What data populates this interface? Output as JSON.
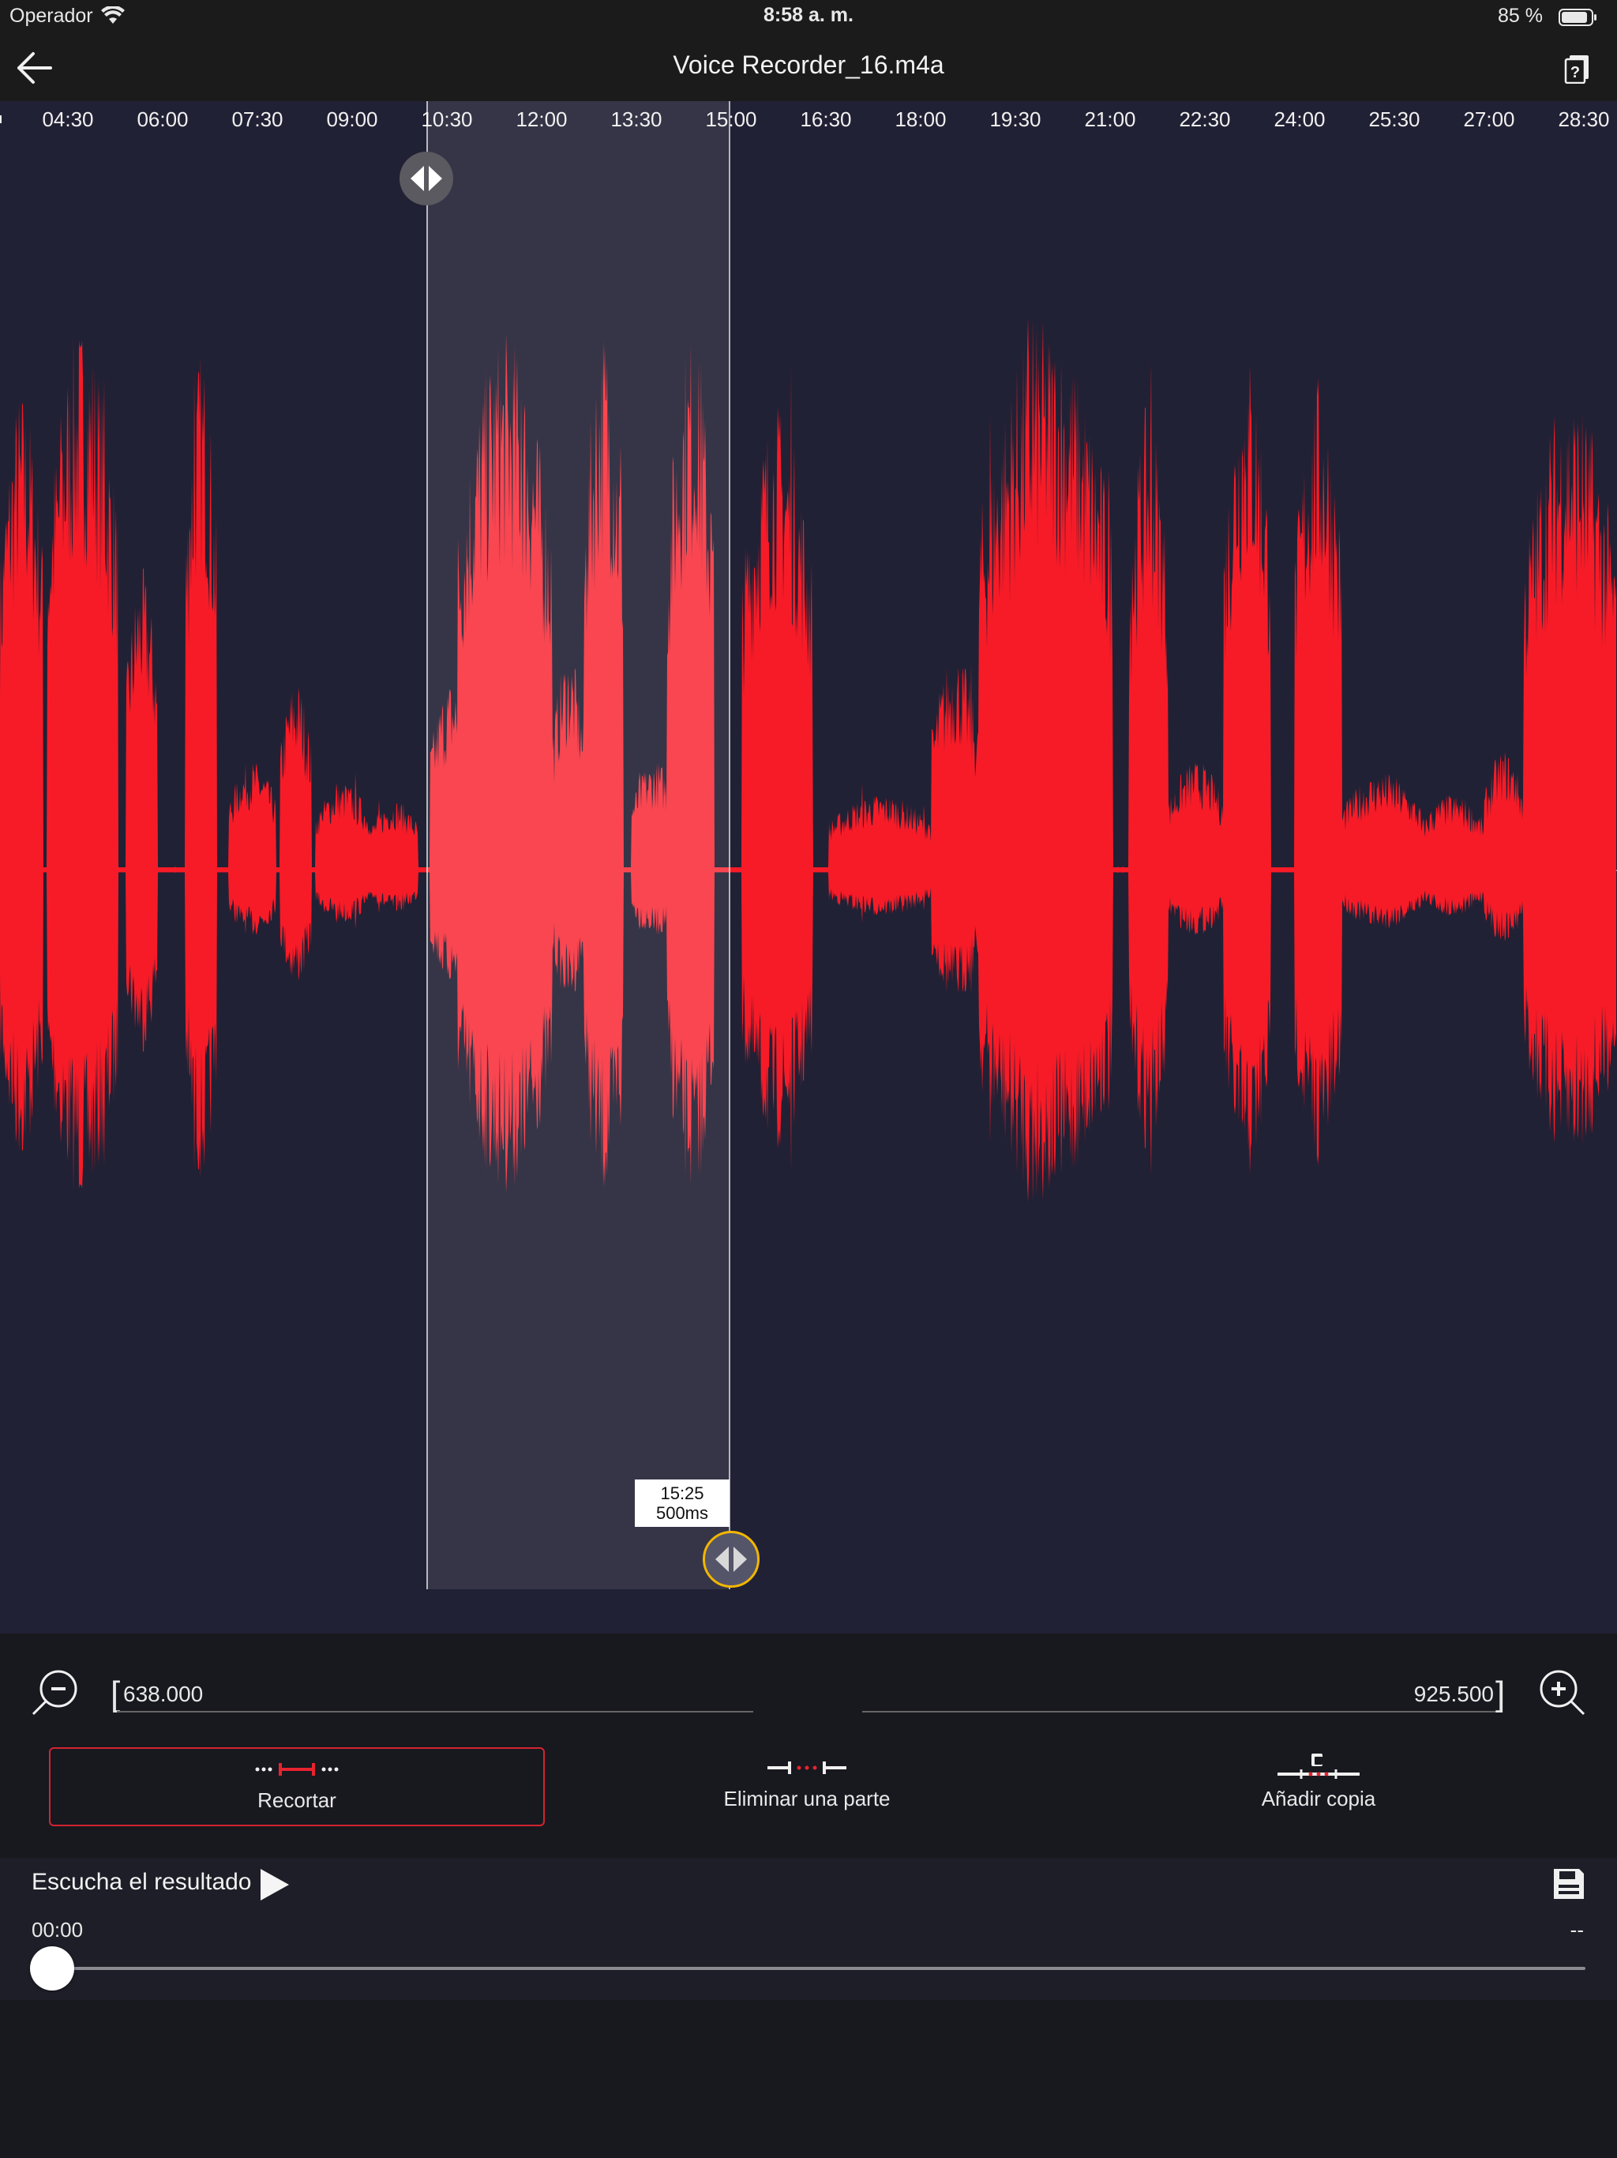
{
  "status_bar": {
    "carrier": "Operador",
    "time": "8:58 a. m.",
    "battery": "85 %",
    "icons": [
      "wifi-icon",
      "battery-icon"
    ]
  },
  "nav": {
    "title": "Voice Recorder_16.m4a",
    "back_icon": "arrow-left-icon",
    "info_icon": "document-question-icon"
  },
  "timeline": {
    "ticks": [
      "04:30",
      "06:00",
      "07:30",
      "09:00",
      "10:30",
      "12:00",
      "13:30",
      "15:00",
      "16:30",
      "18:00",
      "19:30",
      "21:00",
      "22:30",
      "24:00",
      "25:30",
      "27:00",
      "28:30"
    ]
  },
  "waveform": {
    "color": "#f71b27",
    "selection_color": "#fa3440",
    "background": "#212135",
    "handle_active_border": "#f2b600"
  },
  "tooltip": {
    "time": "15:25",
    "ms": "500ms"
  },
  "range": {
    "start_bracket": "[",
    "end_bracket": "]",
    "start_value": "638.000",
    "end_value": "925.500"
  },
  "modes": [
    {
      "label": "Recortar",
      "icon": "trim-icon",
      "selected": true
    },
    {
      "label": "Eliminar una parte",
      "icon": "delete-part-icon",
      "selected": false
    },
    {
      "label": "Añadir copia",
      "icon": "add-copy-icon",
      "selected": false
    }
  ],
  "player": {
    "listen_label": "Escucha el resultado",
    "elapsed": "00:00",
    "total": "--",
    "progress": 0,
    "icons": [
      "play-icon",
      "save-icon"
    ]
  },
  "colors": {
    "accent_red": "#d3242f",
    "panel": "#18181f",
    "player_bg": "#1e1e28",
    "bar_bg": "#1b1b1b"
  }
}
